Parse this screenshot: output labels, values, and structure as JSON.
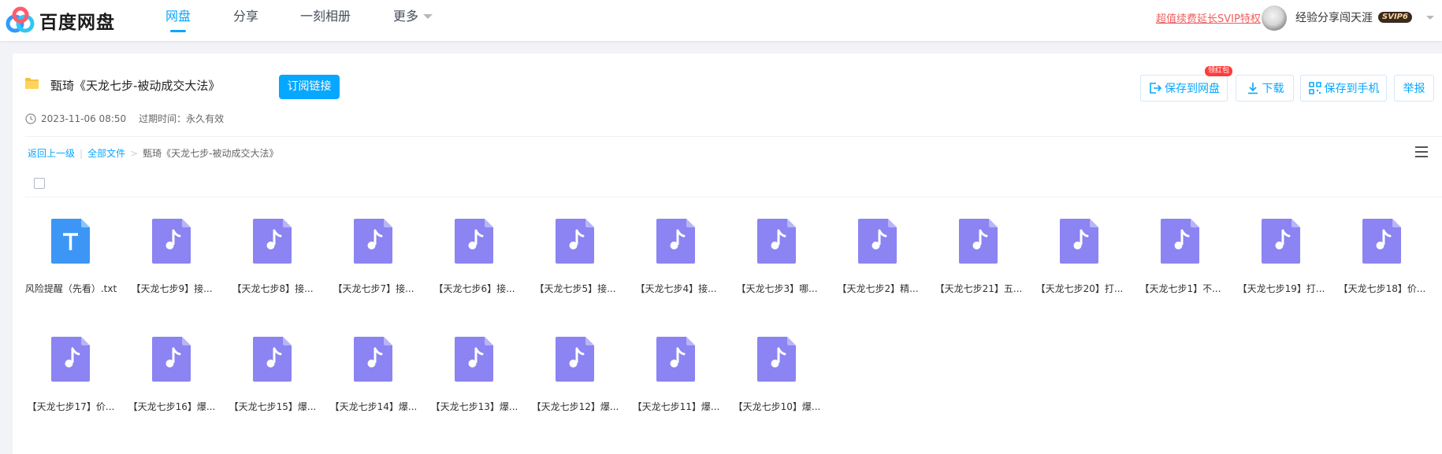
{
  "brand": {
    "name": "百度网盘"
  },
  "nav": {
    "items": [
      {
        "label": "网盘",
        "active": true
      },
      {
        "label": "分享",
        "active": false
      },
      {
        "label": "一刻相册",
        "active": false
      },
      {
        "label": "更多",
        "active": false
      }
    ]
  },
  "user": {
    "promo": "超值续费延长SVIP特权",
    "name": "经验分享闯天涯",
    "badge": "SVIP6"
  },
  "share": {
    "title": "甄琦《天龙七步-被动成交大法》",
    "subscribe": "订阅链接",
    "date": "2023-11-06 08:50",
    "expire": "过期时间：永久有效"
  },
  "toolbar": {
    "save": "保存到网盘",
    "hongbao": "领红包",
    "download": "下载",
    "save_phone": "保存到手机",
    "report": "举报"
  },
  "breadcrumb": {
    "back": "返回上一级",
    "all": "全部文件",
    "current": "甄琦《天龙七步-被动成交大法》"
  },
  "colors": {
    "accent": "#06a7ff",
    "audio": "#8b84f2",
    "text_file": "#3d96f5"
  },
  "files": [
    {
      "name": "风险提醒（先看）.txt",
      "type": "text"
    },
    {
      "name": "【天龙七步9】接...",
      "type": "audio"
    },
    {
      "name": "【天龙七步8】接...",
      "type": "audio"
    },
    {
      "name": "【天龙七步7】接...",
      "type": "audio"
    },
    {
      "name": "【天龙七步6】接...",
      "type": "audio"
    },
    {
      "name": "【天龙七步5】接...",
      "type": "audio"
    },
    {
      "name": "【天龙七步4】接...",
      "type": "audio"
    },
    {
      "name": "【天龙七步3】哪...",
      "type": "audio"
    },
    {
      "name": "【天龙七步2】精...",
      "type": "audio"
    },
    {
      "name": "【天龙七步21】五...",
      "type": "audio"
    },
    {
      "name": "【天龙七步20】打...",
      "type": "audio"
    },
    {
      "name": "【天龙七步1】不...",
      "type": "audio"
    },
    {
      "name": "【天龙七步19】打...",
      "type": "audio"
    },
    {
      "name": "【天龙七步18】价...",
      "type": "audio"
    },
    {
      "name": "【天龙七步17】价...",
      "type": "audio"
    },
    {
      "name": "【天龙七步16】爆...",
      "type": "audio"
    },
    {
      "name": "【天龙七步15】爆...",
      "type": "audio"
    },
    {
      "name": "【天龙七步14】爆...",
      "type": "audio"
    },
    {
      "name": "【天龙七步13】爆...",
      "type": "audio"
    },
    {
      "name": "【天龙七步12】爆...",
      "type": "audio"
    },
    {
      "name": "【天龙七步11】爆...",
      "type": "audio"
    },
    {
      "name": "【天龙七步10】爆...",
      "type": "audio"
    }
  ]
}
